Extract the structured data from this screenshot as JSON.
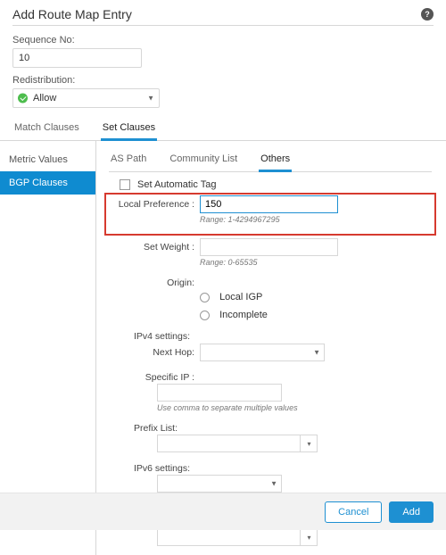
{
  "header": {
    "title": "Add Route Map Entry"
  },
  "fields": {
    "sequence_label": "Sequence No:",
    "sequence_value": "10",
    "redistribution_label": "Redistribution:",
    "redistribution_value": "Allow"
  },
  "outer_tabs": {
    "match": "Match Clauses",
    "set": "Set Clauses"
  },
  "side": {
    "metric": "Metric Values",
    "bgp": "BGP Clauses"
  },
  "inner_tabs": {
    "aspath": "AS Path",
    "comm": "Community List",
    "others": "Others"
  },
  "others": {
    "auto_tag_label": "Set Automatic Tag",
    "local_pref_label": "Local Preference :",
    "local_pref_value": "150",
    "local_pref_range": "Range: 1-4294967295",
    "set_weight_label": "Set Weight :",
    "set_weight_value": "",
    "set_weight_range": "Range: 0-65535",
    "origin_label": "Origin:",
    "origin_local_igp": "Local IGP",
    "origin_incomplete": "Incomplete",
    "ipv4_label": "IPv4 settings:",
    "next_hop_label": "Next Hop:",
    "next_hop_value": "",
    "specific_ip_label": "Specific IP :",
    "specific_ip_value": "",
    "comma_hint": "Use comma to separate multiple values",
    "prefix_list_label": "Prefix List:",
    "prefix_list_value": "",
    "ipv6_label": "IPv6 settings:",
    "ipv6_sel_value": "",
    "ipv6_ip_value": "",
    "ipv6_prefix_value": ""
  },
  "footer": {
    "cancel": "Cancel",
    "add": "Add"
  }
}
